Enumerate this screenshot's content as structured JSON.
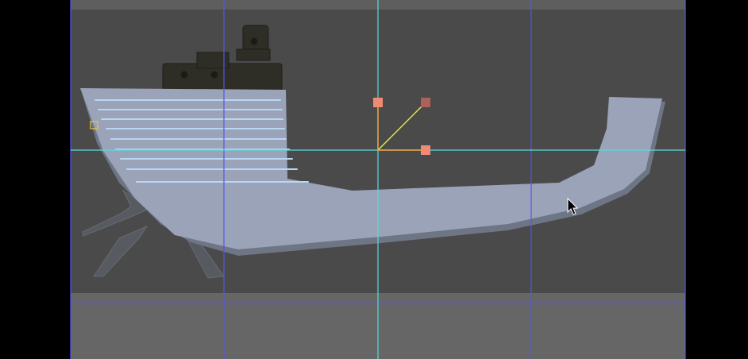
{
  "viewport": {
    "background_color": "#000000",
    "canvas_color": "#4a4a4a",
    "lower_band_color": "#666666",
    "top_band_color": "#5e5e5e",
    "guide_blue": "#5555ee",
    "guide_cyan": "#55dddd",
    "shape_fill": "#9aa3b8",
    "shape_edge": "#6e7585",
    "hatch_color": "#b9d6f2",
    "handle_color": "#f08a74",
    "handle_dark": "#b0605a",
    "gizmo_yellow": "#e6e64a",
    "gizmo_orange": "#f0a040",
    "pivot_color": "#e8c040"
  },
  "icons": {
    "cursor": "mouse-pointer-icon",
    "pivot": "pivot-point-icon"
  },
  "gizmo": {
    "handles": [
      "rotation-handle",
      "scale-handle-top",
      "scale-handle-right"
    ]
  }
}
